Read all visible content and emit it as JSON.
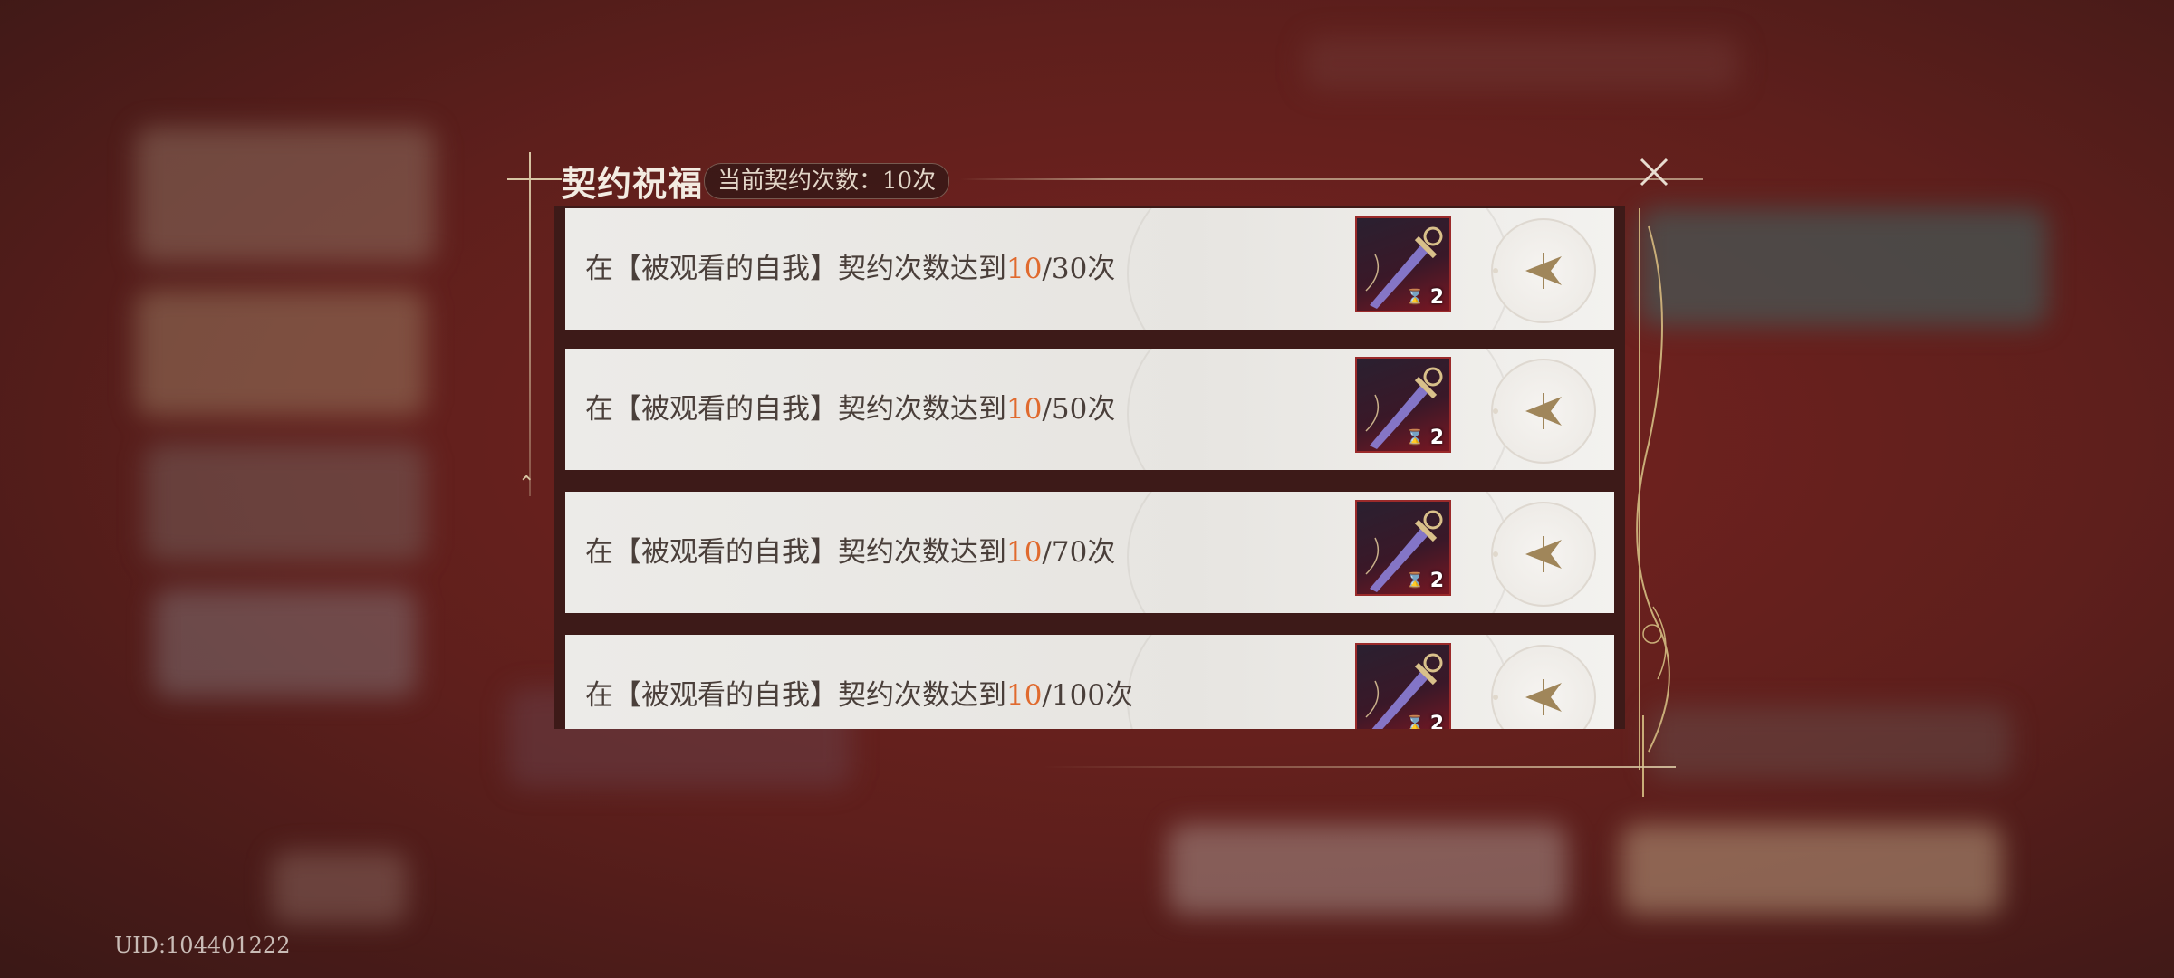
{
  "dialog": {
    "title": "契约祝福",
    "count_label": "当前契约次数：10次",
    "close_icon": "close-icon"
  },
  "rows": [
    {
      "prefix": "在【被观看的自我】契约次数达到",
      "current": "10",
      "suffix": "/30次",
      "reward_qty": "2"
    },
    {
      "prefix": "在【被观看的自我】契约次数达到",
      "current": "10",
      "suffix": "/50次",
      "reward_qty": "2"
    },
    {
      "prefix": "在【被观看的自我】契约次数达到",
      "current": "10",
      "suffix": "/70次",
      "reward_qty": "2"
    },
    {
      "prefix": "在【被观看的自我】契约次数达到",
      "current": "10",
      "suffix": "/100次",
      "reward_qty": "2"
    }
  ],
  "footer": {
    "uid": "UID:104401222"
  },
  "colors": {
    "highlight": "#e06a2e",
    "gold": "#a0865a",
    "background": "#5e1f1c"
  }
}
